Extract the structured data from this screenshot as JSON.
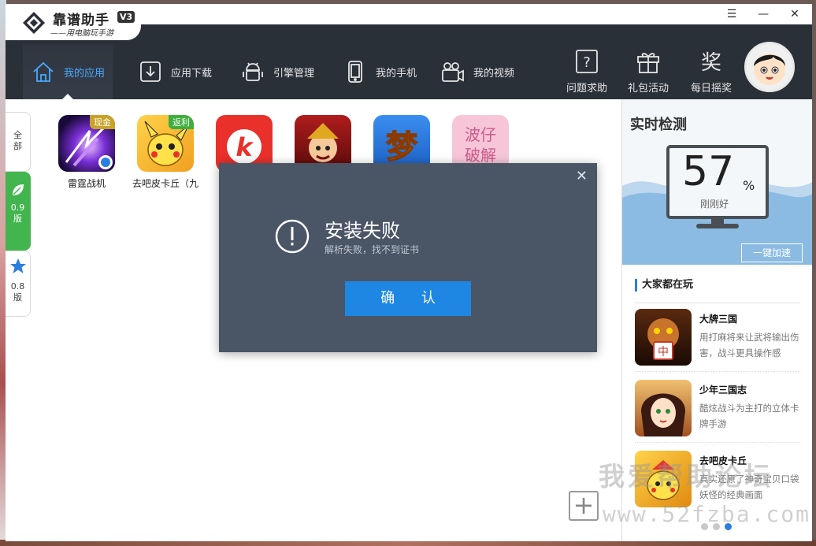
{
  "app": {
    "title": "靠谱助手",
    "version": "V3",
    "subtitle": "——用电脑玩手游"
  },
  "window_controls": {
    "menu": "☰",
    "minimize": "—",
    "close": "✕"
  },
  "nav": {
    "items": [
      {
        "label": "我的应用",
        "icon": "home-icon",
        "active": true
      },
      {
        "label": "应用下载",
        "icon": "download-icon"
      },
      {
        "label": "引擎管理",
        "icon": "android-icon"
      },
      {
        "label": "我的手机",
        "icon": "phone-icon"
      },
      {
        "label": "我的视频",
        "icon": "video-icon"
      }
    ],
    "right": [
      {
        "label": "问题求助",
        "icon": "help-icon"
      },
      {
        "label": "礼包活动",
        "icon": "gift-icon"
      },
      {
        "label": "每日摇奖",
        "icon": "lottery-icon"
      }
    ]
  },
  "side_tabs": [
    {
      "label": "全\n部"
    },
    {
      "label": "0.9\n版",
      "icon": "leaf-icon"
    },
    {
      "label": "0.8\n版",
      "icon": "star-icon"
    }
  ],
  "apps": [
    {
      "label": "雷霆战机",
      "badge": "现金",
      "badge_color": "#c9a227"
    },
    {
      "label": "去吧皮卡丘（九",
      "badge": "返利",
      "badge_color": "#3fae3f"
    },
    {
      "label": ""
    },
    {
      "label": ""
    },
    {
      "label": ""
    },
    {
      "label": ""
    }
  ],
  "app_icon_text": {
    "k": "k",
    "meng": "梦",
    "pojie": "波仔破解"
  },
  "monitor": {
    "title": "实时检测",
    "percent": "57",
    "percent_sign": "%",
    "status": "刚刚好",
    "button": "一键加速"
  },
  "hot": {
    "title": "大家都在玩",
    "items": [
      {
        "name": "大牌三国",
        "desc": "用打麻将来让武将输出伤害，战斗更具操作感"
      },
      {
        "name": "少年三国志",
        "desc": "酷炫战斗为主打的立体卡牌手游"
      },
      {
        "name": "去吧皮卡丘",
        "desc": "真实还原了神奇宝贝口袋妖怪的经典画面"
      }
    ]
  },
  "watermark": {
    "line1": "我爱帮助论坛",
    "line2": "www.52fzba.com"
  },
  "add_button": "+",
  "dialog": {
    "close": "✕",
    "title": "安装失败",
    "message": "解析失败，找不到证书",
    "confirm": "确 认"
  },
  "colors": {
    "accent": "#1e86e3",
    "nav_bg": "#2a3038",
    "dialog_bg": "#4a5566",
    "green": "#43b54e"
  }
}
